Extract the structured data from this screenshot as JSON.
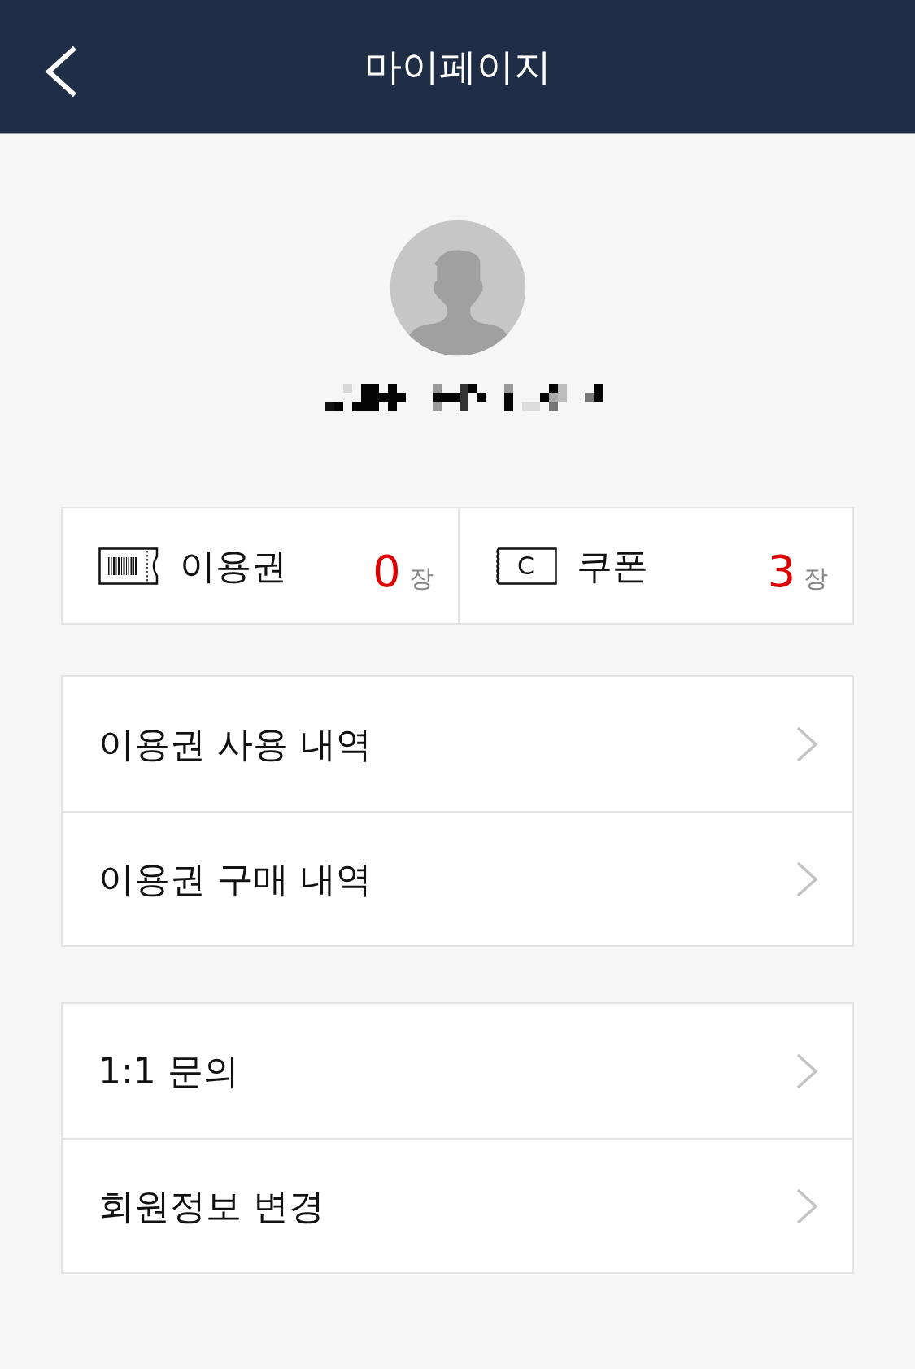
{
  "header": {
    "title": "마이페이지"
  },
  "summary": [
    {
      "kind": "pass",
      "label": "이용권",
      "count": "0",
      "unit": "장"
    },
    {
      "kind": "coupon",
      "label": "쿠폰",
      "icon_letter": "C",
      "count": "3",
      "unit": "장"
    }
  ],
  "menu_groups": [
    {
      "items": [
        {
          "label": "이용권 사용 내역"
        },
        {
          "label": "이용권 구매 내역"
        }
      ]
    },
    {
      "items": [
        {
          "label": "1:1 문의"
        },
        {
          "label": "회원정보 변경"
        }
      ]
    }
  ]
}
